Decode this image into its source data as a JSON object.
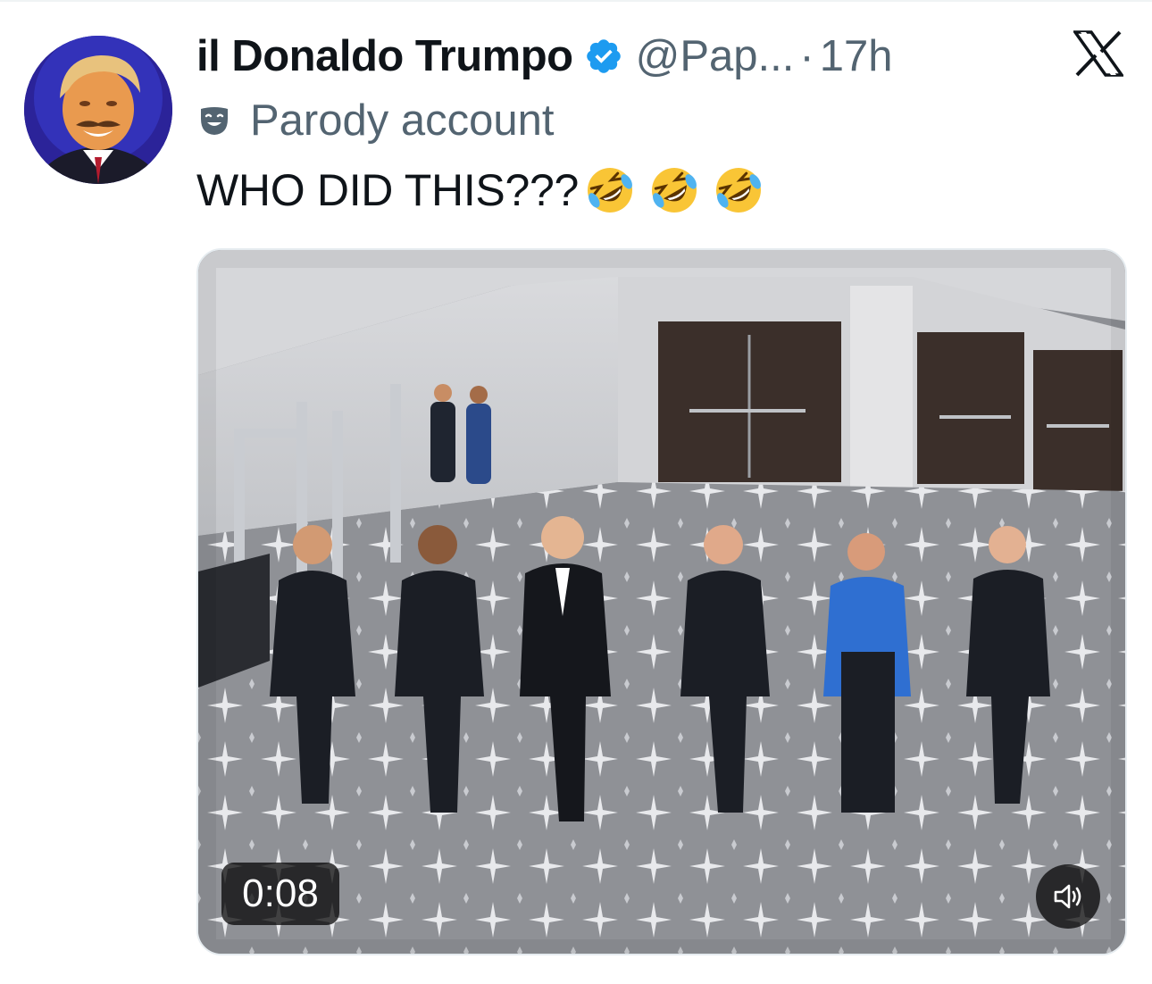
{
  "author": {
    "display_name": "il Donaldo Trumpo",
    "handle": "@Pap...",
    "separator": "·",
    "time": "17h",
    "verified": true,
    "parody_label": "Parody account"
  },
  "tweet": {
    "text": "WHO DID THIS???",
    "emojis": [
      "rolling-on-floor-laughing",
      "rolling-on-floor-laughing",
      "rolling-on-floor-laughing"
    ]
  },
  "video": {
    "timestamp": "0:08",
    "icons": {
      "volume": "speaker-icon"
    }
  },
  "icons": {
    "verified": "verified-badge-icon",
    "parody": "theater-mask-icon",
    "platform": "x-logo-icon"
  },
  "colors": {
    "text": "#0f1419",
    "secondary_text": "#536471",
    "verified_blue": "#1d9bf0"
  }
}
